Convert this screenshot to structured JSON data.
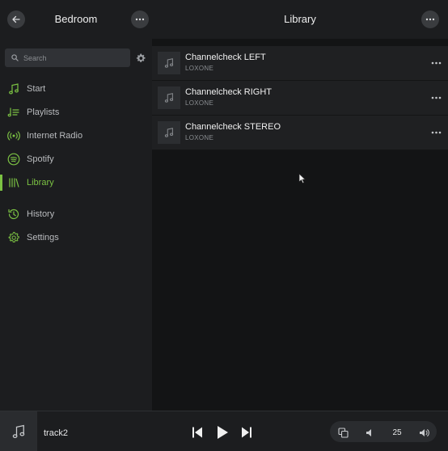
{
  "sidebar": {
    "title": "Bedroom",
    "back_icon": "arrow-left-icon",
    "more_icon": "more-horizontal-icon",
    "search": {
      "placeholder": "Search",
      "icon": "search-icon",
      "settings_icon": "gear-icon"
    },
    "items": [
      {
        "label": "Start",
        "icon": "music-note-icon",
        "active": false
      },
      {
        "label": "Playlists",
        "icon": "playlist-icon",
        "active": false
      },
      {
        "label": "Internet Radio",
        "icon": "radio-waves-icon",
        "active": false
      },
      {
        "label": "Spotify",
        "icon": "spotify-icon",
        "active": false
      },
      {
        "label": "Library",
        "icon": "library-icon",
        "active": true
      },
      {
        "label": "History",
        "icon": "history-icon",
        "active": false
      },
      {
        "label": "Settings",
        "icon": "gear-icon",
        "active": false
      }
    ]
  },
  "main": {
    "title": "Library",
    "more_icon": "more-horizontal-icon",
    "tracks": [
      {
        "title": "Channelcheck LEFT",
        "subtitle": "LOXONE"
      },
      {
        "title": "Channelcheck RIGHT",
        "subtitle": "LOXONE"
      },
      {
        "title": "Channelcheck STEREO",
        "subtitle": "LOXONE"
      }
    ]
  },
  "player": {
    "track": "track2",
    "volume": "25",
    "icons": {
      "art": "music-note-icon",
      "previous": "skip-previous-icon",
      "play": "play-icon",
      "next": "skip-next-icon",
      "group": "group-zones-icon",
      "volume_down": "volume-down-icon",
      "volume_up": "volume-up-icon"
    }
  },
  "colors": {
    "accent": "#7bc143",
    "sidebar_bg": "#1c1d1f",
    "main_bg": "#131415",
    "row_bg": "#1f2022",
    "text": "#e6e7e8",
    "muted": "#8a8d91"
  }
}
